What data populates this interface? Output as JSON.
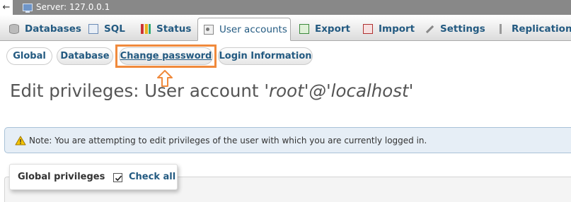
{
  "server_bar": {
    "back_icon": "back-arrow-icon",
    "label": "Server: 127.0.0.1"
  },
  "tabs": [
    {
      "label": "Databases",
      "icon": "database-icon"
    },
    {
      "label": "SQL",
      "icon": "sql-icon"
    },
    {
      "label": "Status",
      "icon": "status-icon"
    },
    {
      "label": "User accounts",
      "icon": "user-accounts-icon",
      "active": true
    },
    {
      "label": "Export",
      "icon": "export-icon"
    },
    {
      "label": "Import",
      "icon": "import-icon"
    },
    {
      "label": "Settings",
      "icon": "settings-icon"
    },
    {
      "label": "Replication",
      "icon": "replication-icon"
    }
  ],
  "subtabs": [
    {
      "label": "Global"
    },
    {
      "label": "Database"
    },
    {
      "label": "Change password",
      "highlighted": true
    },
    {
      "label": "Login Information"
    }
  ],
  "heading": {
    "prefix": "Edit privileges: User account ",
    "account": "'root'@'localhost'"
  },
  "note": {
    "icon": "warning-icon",
    "text": "Note: You are attempting to edit privileges of the user with which you are currently logged in."
  },
  "global_privileges": {
    "title": "Global privileges",
    "check_all_label": "Check all",
    "check_all_checked": true
  },
  "colors": {
    "link": "#235a81",
    "highlight": "#f08a3c",
    "server_bar": "#888888",
    "note_bg": "#e6eef6"
  }
}
